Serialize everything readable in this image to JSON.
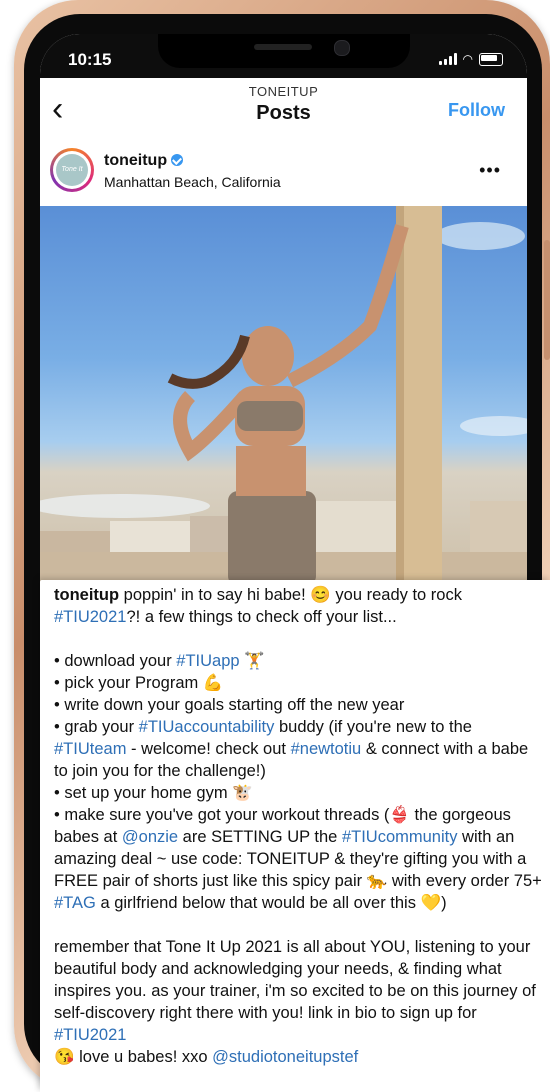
{
  "status_bar": {
    "time": "10:15"
  },
  "header": {
    "subtitle": "TONEITUP",
    "title": "Posts",
    "back_icon": "chevron-left-icon",
    "follow_label": "Follow"
  },
  "post": {
    "username": "toneitup",
    "location": "Manhattan Beach, California",
    "avatar_text": "Tone It Up",
    "more_icon": "ellipsis-icon"
  },
  "caption": {
    "author": "toneitup",
    "intro_1": " poppin' in to say hi babe! ",
    "intro_2": " you ready to rock ",
    "intro_tag": "#TIU2021",
    "intro_3": "?! a few things to check off your list...",
    "b1_text": "• download your ",
    "b1_tag": "#TIUapp",
    "b2_text": "• pick your Program ",
    "b3_text": "• write down your goals starting off the new year",
    "b4_a": "• grab your ",
    "b4_tag1": "#TIUaccountability",
    "b4_b": " buddy (if you're new to the ",
    "b4_tag2": "#TIUteam",
    "b4_c": " - welcome! check out ",
    "b4_tag3": "#newtotiu",
    "b4_d": " & connect with a babe to join you for the challenge!)",
    "b5_text": "• set up your home gym ",
    "b6_a": "• make sure you've got your workout threads (",
    "b6_b": " the gorgeous babes at ",
    "b6_mention": "@onzie",
    "b6_c": " are SETTING UP the ",
    "b6_tag": "#TIUcommunity",
    "b6_d": " with an amazing deal ~ use code: TONEITUP & they're gifting you with a FREE pair of shorts just like this spicy pair ",
    "b6_e": " with every order 75+",
    "b7_tag": "#TAG",
    "b7_text": " a girlfriend below that would be all over this ",
    "b7_end": ")",
    "closing_a": "remember that Tone It Up 2021 is all about YOU, listening to your beautiful body and acknowledging your needs, & finding what inspires you. as your trainer, i'm so excited to be on this journey of self-discovery right there with you! link in bio to sign up for ",
    "closing_tag": "#TIU2021",
    "closing_b": " love u babes! xxo ",
    "closing_mention": "@studiotoneitupstef",
    "emoji_smile": "😊",
    "emoji_dumbbell": "🏋",
    "emoji_muscle": "💪",
    "emoji_bull": "🐮",
    "emoji_shirt": "👙",
    "emoji_leopard": "🐆",
    "emoji_heart": "💛",
    "emoji_kiss": "😘"
  }
}
